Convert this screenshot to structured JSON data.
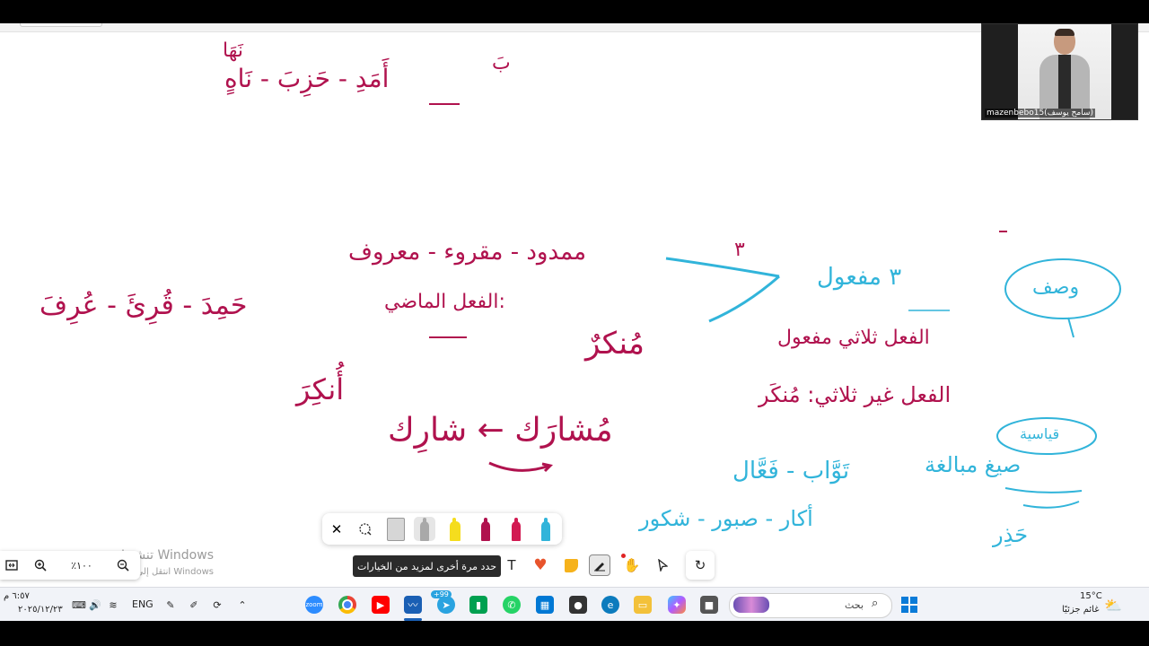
{
  "canvas": {
    "handwriting": {
      "l1": "نَهَا",
      "l2": "أَمَدِ - حَزِبَ - نَاهٍ",
      "l3": "بَ",
      "l4": "ممدود - مقروء - معروف",
      "l5": "٣",
      "l6": "٣ مفعول",
      "l7": "وصف",
      "l8": "حَمِدَ - قُرِئَ - عُرِفَ",
      "l9": "الفعل الماضي:",
      "l10": "مُنكرٌ",
      "l11": "الفعل ثلاثي مفعول",
      "l12": "أُنكِرَ",
      "l13": "الفعل غير ثلاثي: مُنكَر",
      "l14": "مُشارَك ← شارِك",
      "l15": "صيغ مبالغة",
      "l16": "قياسية",
      "l17": "تَوَّاب - فَعَّال",
      "l18": "أكار - صبور - شكور",
      "l19": "حَذِر"
    }
  },
  "video": {
    "participant_label": "mazenbebo15(سامح يوسف)"
  },
  "watermark": {
    "title": "تنشيط Windows",
    "subtitle": "انتقل إلى الإعدادات لتنشيط Windows"
  },
  "zoom_controls": {
    "zoom_level": "٪١٠٠"
  },
  "ink_toolbar": {
    "tooltip": "حدد مرة أخرى لمزيد من الخيارات",
    "text_tool": "T"
  },
  "taskbar": {
    "clock_time": "٦:٥٧ م",
    "clock_date": "٢٠٢٥/١٢/٢٣",
    "language": "ENG",
    "search_placeholder": "بحث",
    "telegram_badge": "+99",
    "weather_temp": "15°C",
    "weather_desc": "غائم جزئيًا"
  },
  "colors": {
    "magenta_ink": "#b0124e",
    "cyan_ink": "#31b4da",
    "highlighter": "#f5dd1e"
  }
}
